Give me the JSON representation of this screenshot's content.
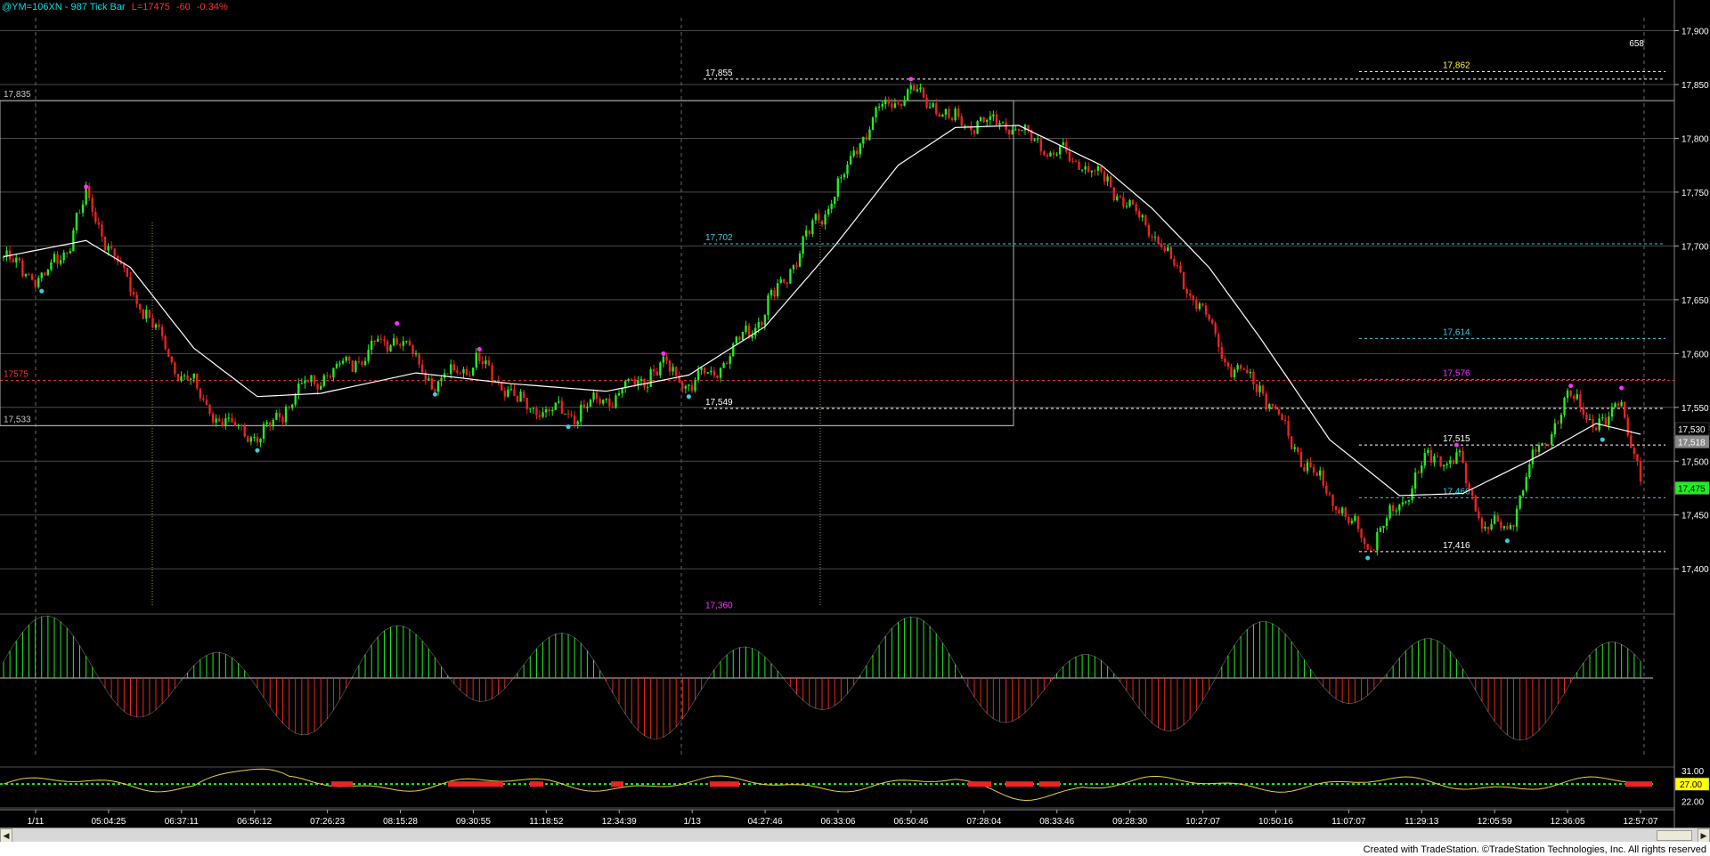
{
  "header": {
    "symbol": "@YM=106XN - 987 Tick Bar",
    "last": "L=17475",
    "change": "-60",
    "percent": "-0.34%"
  },
  "footer": {
    "text": "Created with TradeStation. ©TradeStation Technologies, Inc. All rights reserved"
  },
  "colors": {
    "up": "#22ee22",
    "down": "#ee2222",
    "ma": "#ffffff",
    "accent_cyan": "#30d0e0",
    "accent_magenta": "#ff30ff",
    "level_red": "#ff3030"
  },
  "chart_data": [
    {
      "type": "candlestick",
      "title": "",
      "ylim": [
        17358,
        17912
      ],
      "y_ticks": [
        "17,400",
        "17,450",
        "17,500",
        "17,550",
        "17,600",
        "17,650",
        "17,700",
        "17,750",
        "17,800",
        "17,850",
        "17,900"
      ],
      "x_ticks": [
        "1/11",
        "05:04:25",
        "06:37:11",
        "06:56:12",
        "07:26:23",
        "08:15:28",
        "09:30:55",
        "11:18:52",
        "12:34:39",
        "1/13",
        "04:27:46",
        "06:33:06",
        "06:50:46",
        "07:28:04",
        "08:33:46",
        "09:28:30",
        "10:27:07",
        "10:50:16",
        "11:07:07",
        "11:29:13",
        "12:05:59",
        "12:36:05",
        "12:57:07"
      ],
      "price_path": [
        [
          0,
          17690
        ],
        [
          12,
          17668
        ],
        [
          20,
          17700
        ],
        [
          26,
          17745
        ],
        [
          34,
          17695
        ],
        [
          40,
          17662
        ],
        [
          54,
          17590
        ],
        [
          68,
          17538
        ],
        [
          80,
          17520
        ],
        [
          94,
          17568
        ],
        [
          108,
          17590
        ],
        [
          124,
          17618
        ],
        [
          136,
          17572
        ],
        [
          150,
          17594
        ],
        [
          164,
          17550
        ],
        [
          178,
          17542
        ],
        [
          192,
          17560
        ],
        [
          208,
          17590
        ],
        [
          216,
          17570
        ],
        [
          226,
          17590
        ],
        [
          240,
          17640
        ],
        [
          252,
          17700
        ],
        [
          264,
          17760
        ],
        [
          274,
          17820
        ],
        [
          286,
          17845
        ],
        [
          300,
          17815
        ],
        [
          316,
          17815
        ],
        [
          330,
          17790
        ],
        [
          346,
          17765
        ],
        [
          362,
          17715
        ],
        [
          376,
          17650
        ],
        [
          386,
          17590
        ],
        [
          396,
          17570
        ],
        [
          410,
          17500
        ],
        [
          420,
          17460
        ],
        [
          430,
          17420
        ],
        [
          440,
          17460
        ],
        [
          448,
          17500
        ],
        [
          458,
          17505
        ],
        [
          466,
          17445
        ],
        [
          474,
          17436
        ],
        [
          482,
          17500
        ],
        [
          494,
          17560
        ],
        [
          504,
          17530
        ],
        [
          510,
          17558
        ],
        [
          516,
          17478
        ]
      ],
      "moving_average": [
        [
          0,
          17690
        ],
        [
          26,
          17705
        ],
        [
          40,
          17680
        ],
        [
          60,
          17605
        ],
        [
          80,
          17560
        ],
        [
          100,
          17563
        ],
        [
          130,
          17582
        ],
        [
          160,
          17572
        ],
        [
          190,
          17565
        ],
        [
          216,
          17580
        ],
        [
          240,
          17625
        ],
        [
          262,
          17700
        ],
        [
          282,
          17775
        ],
        [
          300,
          17810
        ],
        [
          320,
          17812
        ],
        [
          346,
          17775
        ],
        [
          362,
          17735
        ],
        [
          380,
          17680
        ],
        [
          396,
          17615
        ],
        [
          418,
          17520
        ],
        [
          440,
          17468
        ],
        [
          460,
          17470
        ],
        [
          484,
          17505
        ],
        [
          502,
          17535
        ],
        [
          516,
          17525
        ]
      ],
      "levels": [
        {
          "label": "17,835",
          "value": 17835,
          "color": "#c8c8c8"
        },
        {
          "label": "17575",
          "value": 17575,
          "color": "#ff3030"
        },
        {
          "label": "17,533",
          "value": 17533,
          "color": "#c8c8c8"
        },
        {
          "label": "17,855",
          "value": 17855,
          "color": "#ffffff"
        },
        {
          "label": "17,702",
          "value": 17702,
          "color": "#30d0e0"
        },
        {
          "label": "17,549",
          "value": 17549,
          "color": "#ffffff"
        },
        {
          "label": "17,360",
          "value": 17360,
          "color": "#ff30ff"
        },
        {
          "label": "17,862",
          "value": 17862,
          "color": "#ffff40"
        },
        {
          "label": "17,614",
          "value": 17614,
          "color": "#30d0e0"
        },
        {
          "label": "17,576",
          "value": 17576,
          "color": "#ff30ff"
        },
        {
          "label": "17,515",
          "value": 17515,
          "color": "#ffffff"
        },
        {
          "label": "17,466",
          "value": 17466,
          "color": "#30d0e0"
        },
        {
          "label": "17,416",
          "value": 17416,
          "color": "#ffffff"
        }
      ],
      "price_tags": [
        {
          "label": "17,530",
          "value": 17530,
          "bg": "#000000",
          "fg": "#ffffff"
        },
        {
          "label": "17,518",
          "value": 17518,
          "bg": "#888888",
          "fg": "#ffffff"
        },
        {
          "label": "17,475",
          "value": 17475,
          "bg": "#22ee22",
          "fg": "#000000"
        }
      ],
      "corner_value": "658"
    },
    {
      "type": "oscillator",
      "title": "",
      "note": "histogram around zero, green above / red below"
    },
    {
      "type": "line",
      "y_ticks": [
        "31.00",
        "27.00",
        "22.00"
      ],
      "current_tag": "27.00"
    }
  ]
}
